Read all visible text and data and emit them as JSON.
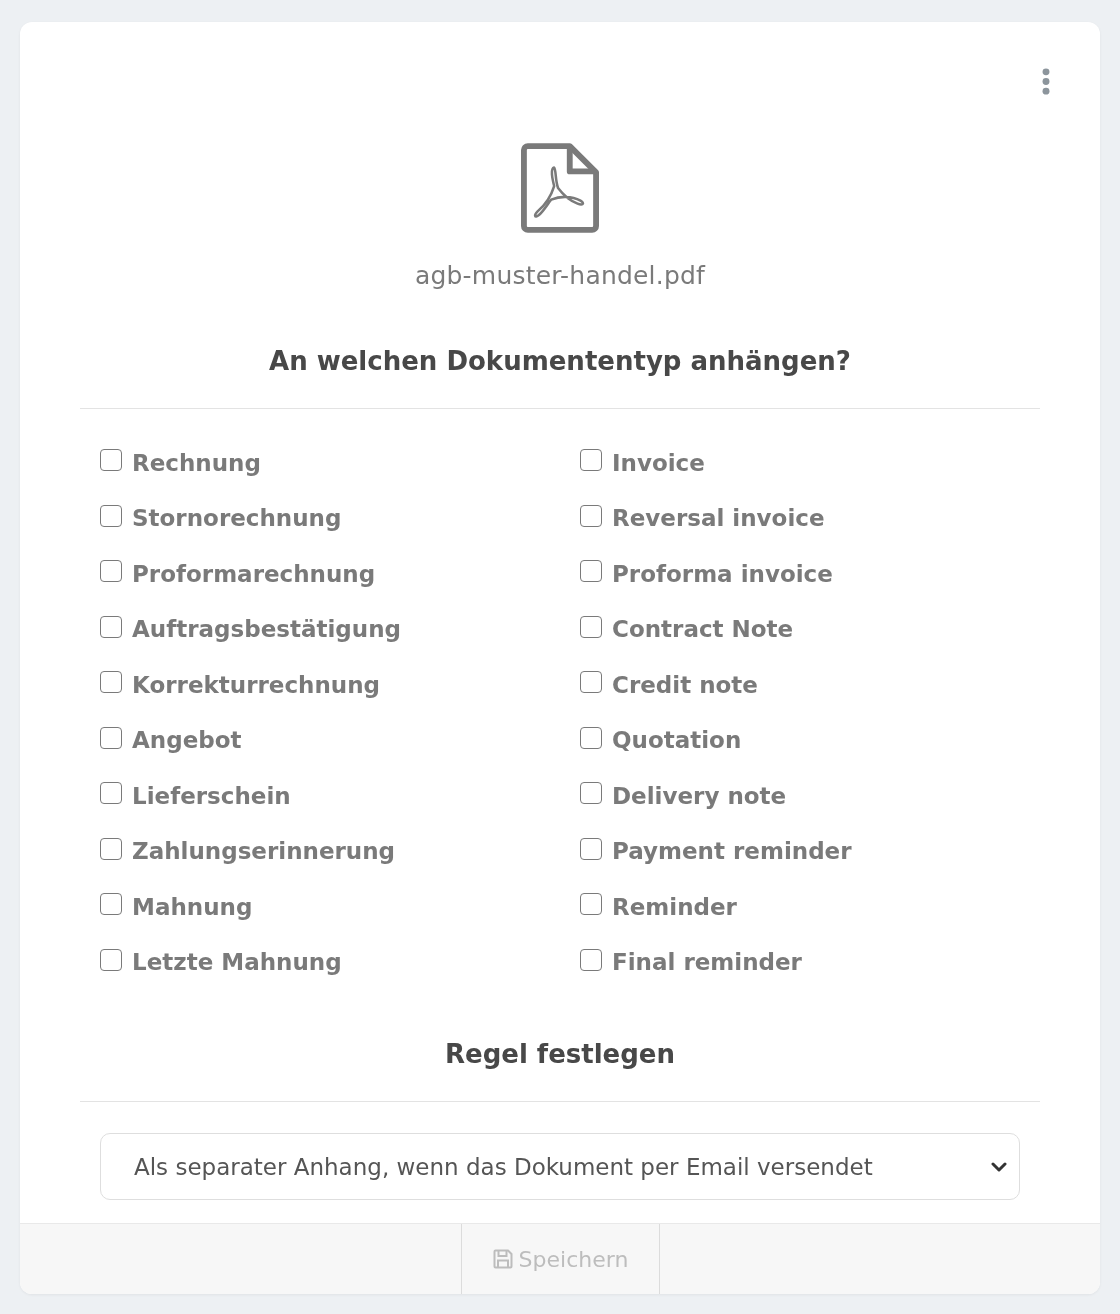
{
  "file": {
    "name": "agb-muster-handel.pdf"
  },
  "document_types": {
    "heading": "An welchen Dokumententyp anhängen?",
    "options": [
      {
        "label": "Rechnung",
        "checked": false
      },
      {
        "label": "Invoice",
        "checked": false
      },
      {
        "label": "Stornorechnung",
        "checked": false
      },
      {
        "label": "Reversal invoice",
        "checked": false
      },
      {
        "label": "Proformarechnung",
        "checked": false
      },
      {
        "label": "Proforma invoice",
        "checked": false
      },
      {
        "label": "Auftragsbestätigung",
        "checked": false
      },
      {
        "label": "Contract Note",
        "checked": false
      },
      {
        "label": "Korrekturrechnung",
        "checked": false
      },
      {
        "label": "Credit note",
        "checked": false
      },
      {
        "label": "Angebot",
        "checked": false
      },
      {
        "label": "Quotation",
        "checked": false
      },
      {
        "label": "Lieferschein",
        "checked": false
      },
      {
        "label": "Delivery note",
        "checked": false
      },
      {
        "label": "Zahlungserinnerung",
        "checked": false
      },
      {
        "label": "Payment reminder",
        "checked": false
      },
      {
        "label": "Mahnung",
        "checked": false
      },
      {
        "label": "Reminder",
        "checked": false
      },
      {
        "label": "Letzte Mahnung",
        "checked": false
      },
      {
        "label": "Final reminder",
        "checked": false
      }
    ]
  },
  "rule": {
    "heading": "Regel festlegen",
    "select": {
      "value": "Als separater Anhang, wenn das Dokument per Email versendet"
    }
  },
  "footer": {
    "save_button": {
      "label": "Speichern",
      "disabled": true
    }
  }
}
